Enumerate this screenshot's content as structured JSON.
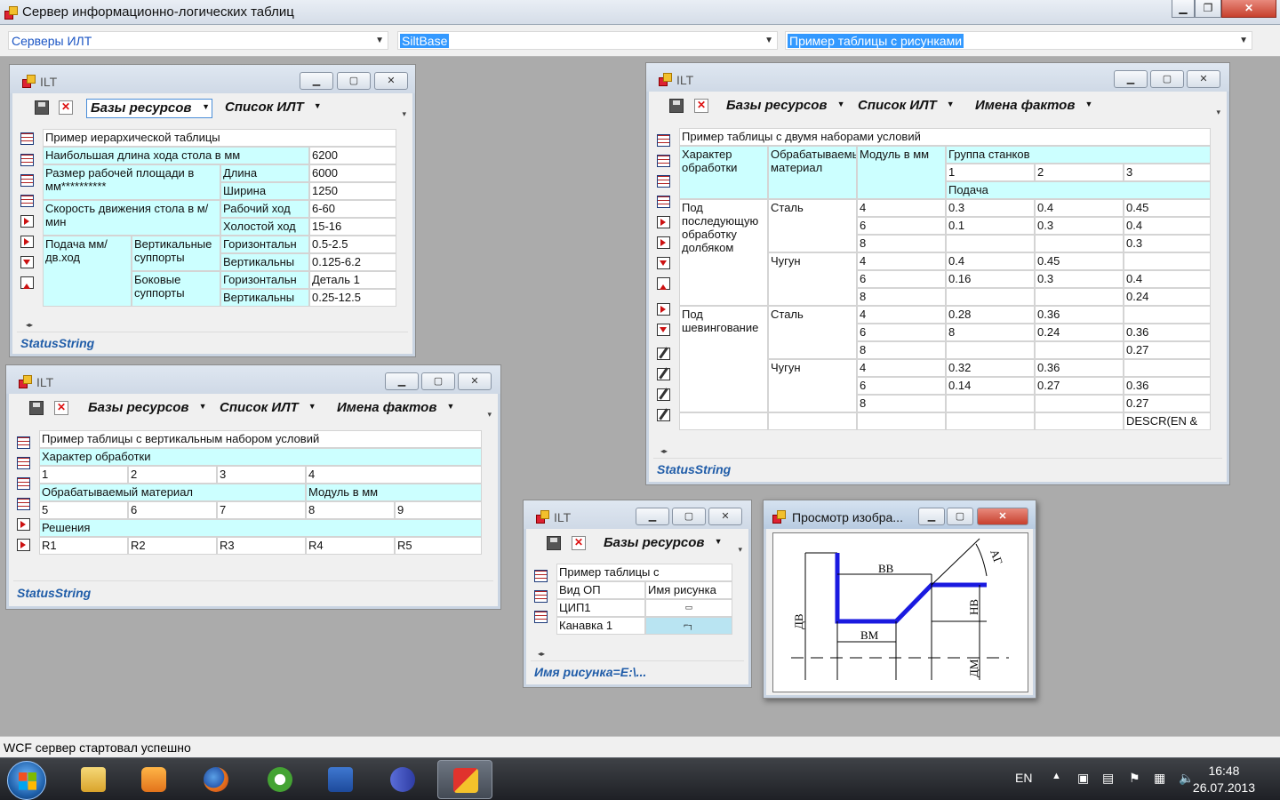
{
  "app": {
    "title": "Сервер информационно-логических таблиц"
  },
  "combos": {
    "server": "Серверы ИЛТ",
    "base": "SiltBase",
    "table": "Пример таблицы с рисунками"
  },
  "toolbar": {
    "resources": "Базы ресурсов",
    "ilt_list": "Список ИЛТ",
    "facts": "Имена фактов"
  },
  "window_title": "ILT",
  "status_string": "StatusString",
  "win1": {
    "rows": [
      [
        "Пример иерархической таблицы"
      ],
      [
        "Наибольшая длина хода стола в мм",
        "6200"
      ],
      [
        "Размер рабочей площади в мм**********",
        "Длина",
        "6000"
      ],
      [
        "Ширина",
        "1250"
      ],
      [
        "Скорость движения стола в м/мин",
        "Рабочий ход",
        "6-60"
      ],
      [
        "Холостой ход",
        "15-16"
      ],
      [
        "Подача мм/дв.ход",
        "Вертикальные суппорты",
        "Горизонтальн",
        "0.5-2.5"
      ],
      [
        "Вертикальны",
        "0.125-6.2"
      ],
      [
        "Боковые суппорты",
        "Горизонтальн",
        "Деталь 1"
      ],
      [
        "Вертикальны",
        "0.25-12.5"
      ]
    ]
  },
  "win2": {
    "title": "Пример таблицы с вертикальным набором условий",
    "char_label": "Характер обработки",
    "char_vals": [
      "1",
      "2",
      "3",
      "4"
    ],
    "material_label": "Обрабатываемый материал",
    "module_label": "Модуль в мм",
    "vals_row": [
      "5",
      "6",
      "7",
      "8",
      "9"
    ],
    "decisions_label": "Решения",
    "decisions": [
      "R1",
      "R2",
      "R3",
      "R4",
      "R5"
    ]
  },
  "win3": {
    "title": "Пример таблицы с двумя наборами условий",
    "h_char": "Характер обработки",
    "h_mat": "Обрабатываемый материал",
    "h_mod": "Модуль в мм",
    "h_group": "Группа станков",
    "groups": [
      "1",
      "2",
      "3"
    ],
    "h_feed": "Подача",
    "op1": "Под последующую обработку долбяком",
    "op2": "Под шевингование",
    "steel": "Сталь",
    "iron": "Чугун",
    "mods": [
      "4",
      "6",
      "8"
    ],
    "data": [
      [
        "0.3",
        "0.4",
        "0.45"
      ],
      [
        "0.1",
        "0.3",
        "0.4"
      ],
      [
        "",
        "",
        "0.3"
      ],
      [
        "0.4",
        "0.45",
        ""
      ],
      [
        "0.16",
        "0.3",
        "0.4"
      ],
      [
        "",
        "",
        "0.24"
      ],
      [
        "0.28",
        "0.36",
        ""
      ],
      [
        "8",
        "0.24",
        "0.36"
      ],
      [
        "",
        "",
        "0.27"
      ],
      [
        "0.32",
        "0.36",
        ""
      ],
      [
        "0.14",
        "0.27",
        "0.36"
      ],
      [
        "",
        "",
        "0.27"
      ]
    ],
    "last": "DESCR(EN &"
  },
  "win4": {
    "title": "Пример таблицы с",
    "h_op": "Вид ОП",
    "h_img": "Имя рисунка",
    "r1": "ЦИП1",
    "r2": "Канавка 1",
    "status": "Имя рисунка=E:\\..."
  },
  "viewer": {
    "title": "Просмотр изобра...",
    "labels": {
      "bb": "ВВ",
      "bm": "ВМ",
      "db": "ДВ",
      "dm": "ДМ",
      "hb": "НВ",
      "ag": "АГ"
    }
  },
  "statusbar": "WCF сервер стартовал успешно",
  "tray": {
    "lang": "EN",
    "time": "16:48",
    "date": "26.07.2013"
  }
}
